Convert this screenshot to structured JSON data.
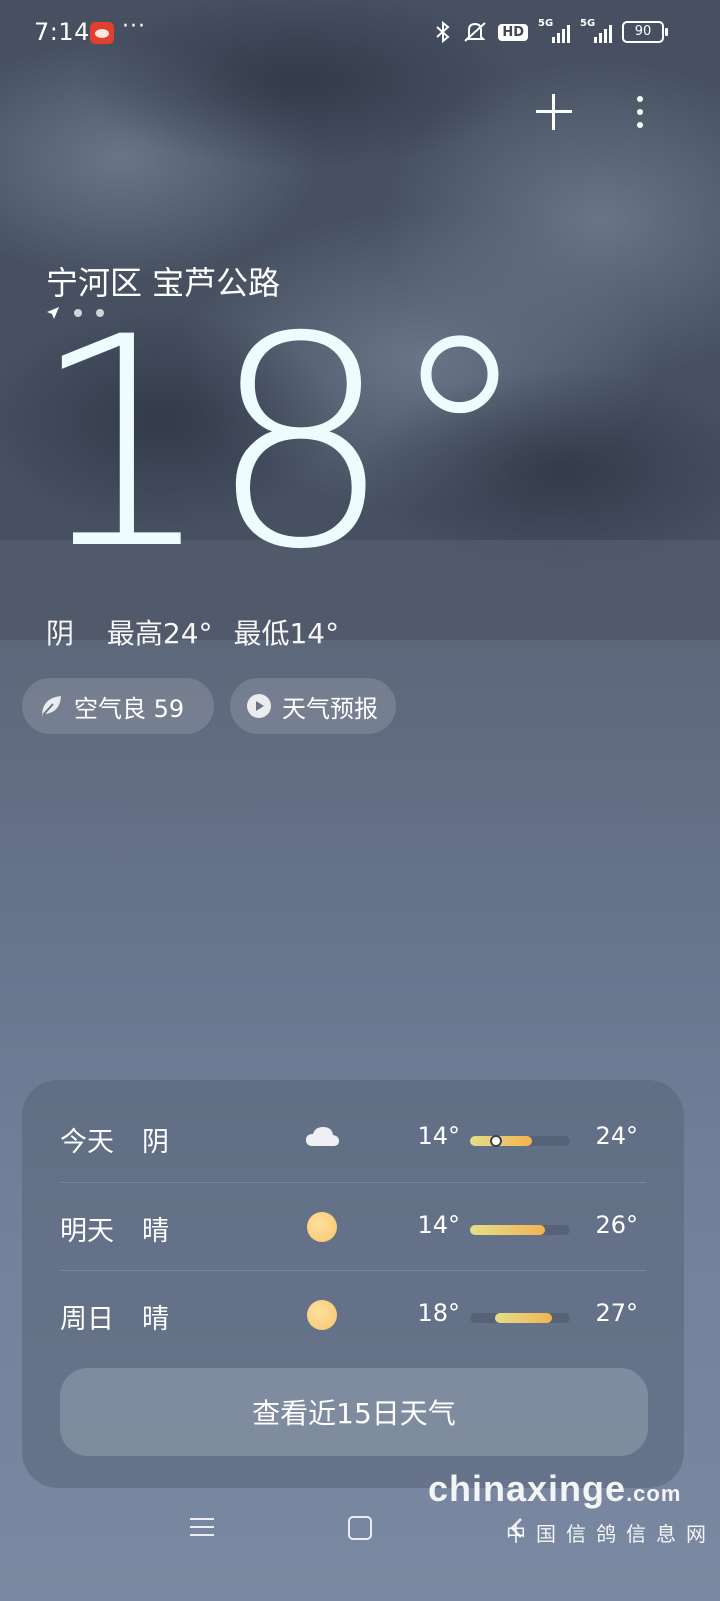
{
  "status_bar": {
    "time": "7:14",
    "more": "···",
    "hd": "HD",
    "net1": "5G",
    "net2": "5G",
    "battery": "90"
  },
  "location": {
    "name": "宁河区 宝芦公路"
  },
  "current": {
    "temperature": "18°",
    "condition": "阴",
    "high": "最高24°",
    "low": "最低14°"
  },
  "chips": {
    "aqi": "空气良 59",
    "forecast": "天气预报"
  },
  "forecast": {
    "days": [
      {
        "name": "今天",
        "condition": "阴",
        "icon": "cloud-icon",
        "low": "14°",
        "high": "24°",
        "bar_start": 0.0,
        "bar_end": 0.62,
        "now": 0.26
      },
      {
        "name": "明天",
        "condition": "晴",
        "icon": "sun-icon",
        "low": "14°",
        "high": "26°",
        "bar_start": 0.0,
        "bar_end": 0.75
      },
      {
        "name": "周日",
        "condition": "晴",
        "icon": "sun-icon",
        "low": "18°",
        "high": "27°",
        "bar_start": 0.25,
        "bar_end": 0.82
      }
    ],
    "more_button": "查看近15日天气"
  },
  "watermark": {
    "main": "chinaxinge",
    "suffix": ".com",
    "sub": "中国信鸽信息网"
  },
  "colors": {
    "bar_yellow": "#e3df8a",
    "bar_orange": "#f4b350"
  }
}
